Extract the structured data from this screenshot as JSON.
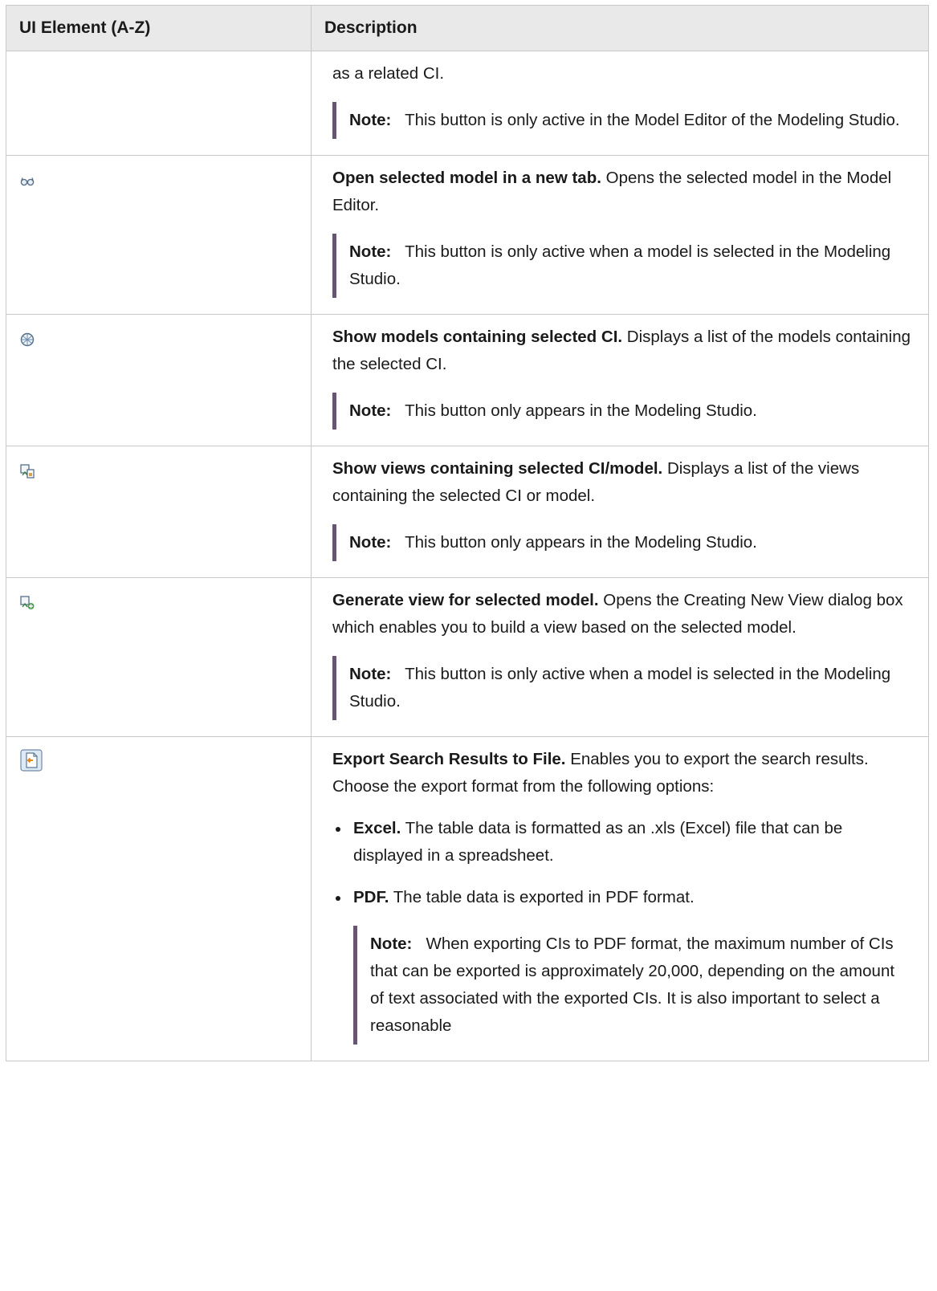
{
  "table": {
    "headers": [
      "UI Element (A-Z)",
      "Description"
    ],
    "rows": [
      {
        "icon": "",
        "desc_text": "as a related CI.",
        "note_label": "Note:",
        "note_text": "This button is only active in the Model Editor of the Modeling Studio."
      },
      {
        "icon": "open-model-in-new-tab-icon",
        "title": "Open selected model in a new tab.",
        "desc_text": "Opens the selected model in the Model Editor.",
        "note_label": "Note:",
        "note_text": "This button is only active when a model is selected in the Modeling Studio."
      },
      {
        "icon": "show-models-containing-ci-icon",
        "title": "Show models containing selected CI.",
        "desc_text": "Displays a list of the models containing the selected CI.",
        "note_label": "Note:",
        "note_text": "This button only appears in the Modeling Studio."
      },
      {
        "icon": "show-views-containing-ci-icon",
        "title": "Show views containing selected CI/model.",
        "desc_text": "Displays a list of the views containing the selected CI or model.",
        "note_label": "Note:",
        "note_text": "This button only appears in the Modeling Studio."
      },
      {
        "icon": "generate-view-icon",
        "title": "Generate view for selected model.",
        "desc_text": "Opens the Creating New View dialog box which enables you to build a view based on the selected model.",
        "note_label": "Note:",
        "note_text": "This button is only active when a model is selected in the Modeling Studio."
      },
      {
        "icon": "export-to-file-icon",
        "title": "Export Search Results to File.",
        "desc_text": "Enables you to export the search results. Choose the export format from the following options:",
        "options": [
          {
            "label": "Excel.",
            "text": "The table data is formatted as an .xls (Excel) file that can be displayed in a spreadsheet."
          },
          {
            "label": "PDF.",
            "text": "The table data is exported in PDF format."
          }
        ],
        "note_label": "Note:",
        "note_text": "When exporting CIs to PDF format, the maximum number of CIs that can be exported is approximately 20,000, depending on the amount of text associated with the exported CIs. It is also important to select a reasonable"
      }
    ]
  }
}
